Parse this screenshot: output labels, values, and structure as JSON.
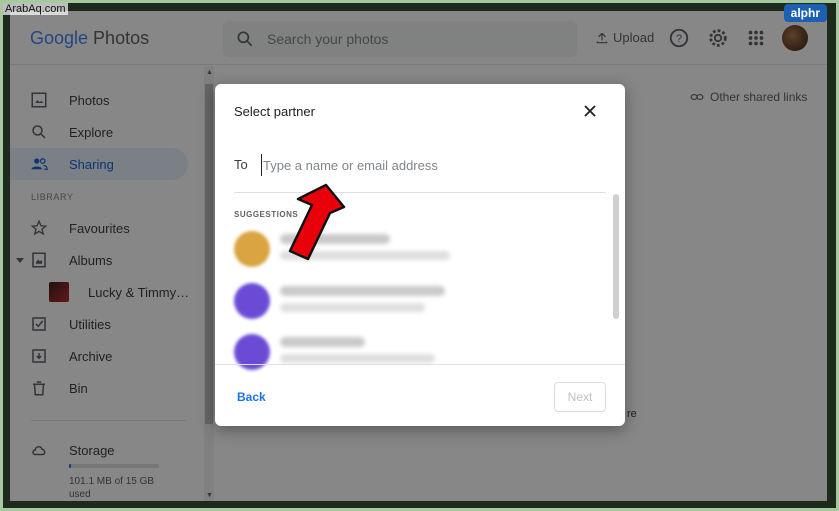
{
  "watermark": "ArabAq.com",
  "badge": "alphr",
  "header": {
    "logo_google": "Google",
    "logo_product": "Photos",
    "search_placeholder": "Search your photos",
    "upload_label": "Upload"
  },
  "sidebar": {
    "items": [
      {
        "label": "Photos",
        "icon": "photo-icon"
      },
      {
        "label": "Explore",
        "icon": "search-icon"
      },
      {
        "label": "Sharing",
        "icon": "people-icon",
        "active": true
      }
    ],
    "library_label": "LIBRARY",
    "library_items": [
      {
        "label": "Favourites",
        "icon": "star-icon"
      },
      {
        "label": "Albums",
        "icon": "album-icon"
      },
      {
        "label": "Lucky & Timmy…",
        "icon": "album-thumbnail"
      },
      {
        "label": "Utilities",
        "icon": "utilities-icon"
      },
      {
        "label": "Archive",
        "icon": "archive-icon"
      },
      {
        "label": "Bin",
        "icon": "trash-icon"
      }
    ],
    "storage": {
      "label": "Storage",
      "usage": "101.1 MB of 15 GB used",
      "used_fraction": 0.0066
    }
  },
  "content": {
    "other_shared_links": "Other shared links",
    "behind_text": "re"
  },
  "dialog": {
    "title": "Select partner",
    "to_label": "To",
    "input_placeholder": "Type a name or email address",
    "suggestions_label": "SUGGESTIONS",
    "suggestions": [
      {
        "avatar_color": "#d9a441"
      },
      {
        "avatar_color": "#6b4bd6"
      },
      {
        "avatar_color": "#6b4bd6"
      }
    ],
    "back_label": "Back",
    "next_label": "Next"
  },
  "colors": {
    "accent": "#1a73e8",
    "active_bg": "#e8f0fe",
    "arrow": "#e8000b"
  }
}
